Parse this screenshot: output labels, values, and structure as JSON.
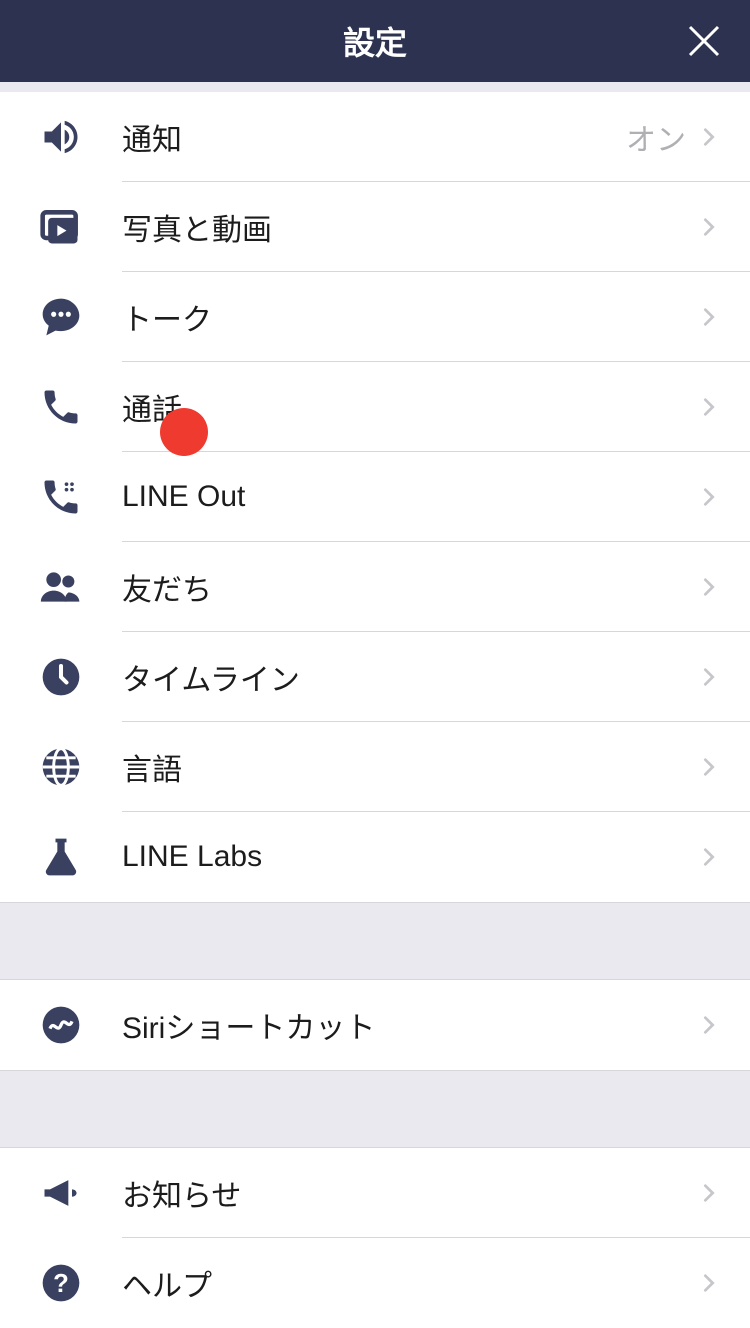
{
  "header": {
    "title": "設定"
  },
  "group1": [
    {
      "icon": "speaker-icon",
      "label": "通知",
      "value": "オン"
    },
    {
      "icon": "media-icon",
      "label": "写真と動画",
      "value": ""
    },
    {
      "icon": "chat-icon",
      "label": "トーク",
      "value": ""
    },
    {
      "icon": "phone-icon",
      "label": "通話",
      "value": ""
    },
    {
      "icon": "lineout-icon",
      "label": "LINE Out",
      "value": ""
    },
    {
      "icon": "friends-icon",
      "label": "友だち",
      "value": ""
    },
    {
      "icon": "clock-icon",
      "label": "タイムライン",
      "value": ""
    },
    {
      "icon": "globe-icon",
      "label": "言語",
      "value": ""
    },
    {
      "icon": "flask-icon",
      "label": "LINE Labs",
      "value": ""
    }
  ],
  "group2": [
    {
      "icon": "siri-icon",
      "label": "Siriショートカット",
      "value": ""
    }
  ],
  "group3": [
    {
      "icon": "megaphone-icon",
      "label": "お知らせ",
      "value": ""
    },
    {
      "icon": "help-icon",
      "label": "ヘルプ",
      "value": ""
    }
  ]
}
